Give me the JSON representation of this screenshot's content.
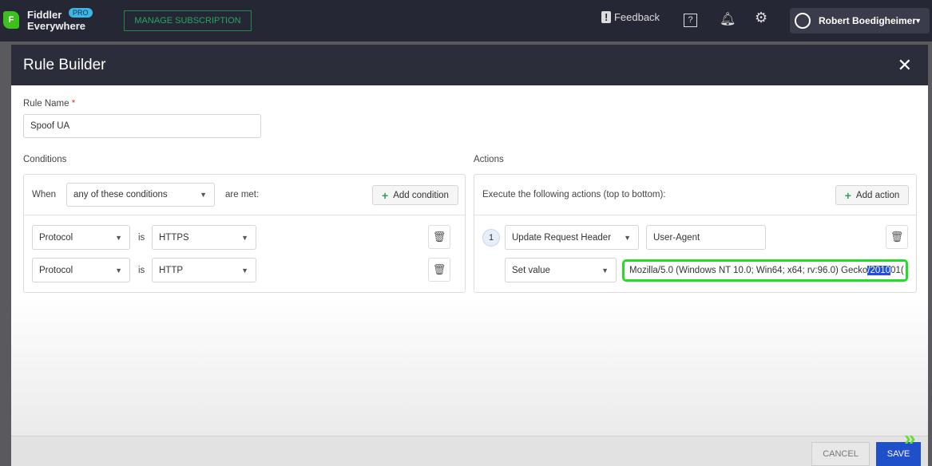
{
  "app": {
    "name_line1": "Fiddler",
    "name_line2": "Everywhere",
    "badge": "PRO",
    "logo_letter": "F",
    "manage_label": "MANAGE SUBSCRIPTION",
    "feedback": "Feedback",
    "user": "Robert Boedigheimer"
  },
  "modal": {
    "title": "Rule Builder",
    "close": "✕"
  },
  "rule_name": {
    "label": "Rule Name",
    "required": "*",
    "value": "Spoof UA"
  },
  "conditions": {
    "label": "Conditions",
    "when": "When",
    "match": "any of these conditions",
    "are_met": "are met:",
    "add_label": "Add condition",
    "rows": [
      {
        "field": "Protocol",
        "op": "is",
        "value": "HTTPS"
      },
      {
        "field": "Protocol",
        "op": "is",
        "value": "HTTP"
      }
    ]
  },
  "actions": {
    "label": "Actions",
    "intro": "Execute the following actions (top to bottom):",
    "add_label": "Add action",
    "items": [
      {
        "number": "1",
        "type": "Update Request Header",
        "header": "User-Agent",
        "mode": "Set value",
        "value_pre": "Mozilla/5.0 (Windows NT 10.0; Win64; x64; rv:96.0) Gecko",
        "value_sel": "/2010",
        "value_post": "01("
      }
    ]
  },
  "footer": {
    "cancel": "CANCEL",
    "save": "SAVE"
  },
  "colors": {
    "accent_green": "#3fbf1f",
    "save_blue": "#1f4fc9",
    "focus_outline": "#22dd22"
  }
}
